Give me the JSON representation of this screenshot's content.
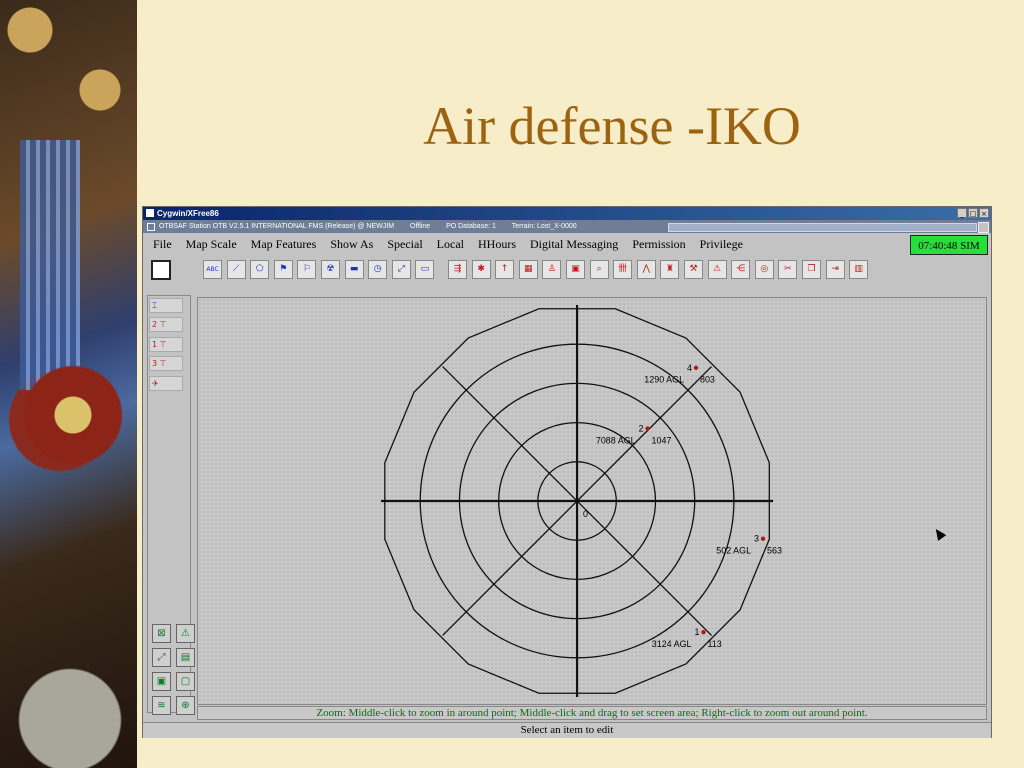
{
  "slide": {
    "title": "Air defense -IKO"
  },
  "window": {
    "xtitle": "Cygwin/XFree86",
    "app_title": "OTBSAF Station OTB V2.5.1 INTERNATIONAL FMS (Release) @ NEWJIM",
    "app_status": "Offline",
    "po_database": "PO Database: 1",
    "terrain": "Terrain: Lost_X-0000"
  },
  "menu": {
    "items": [
      "File",
      "Map Scale",
      "Map Features",
      "Show As",
      "Special",
      "Local",
      "HHours",
      "Digital Messaging",
      "Permission",
      "Privilege"
    ],
    "clock": "07:40:48 SIM"
  },
  "toolbar": {
    "icons": [
      "abc-def-icon",
      "route-icon",
      "area-icon",
      "flag-icon",
      "unit-flag-icon",
      "nbc-icon",
      "tank-icon",
      "clock-icon",
      "line-icon",
      "box-icon",
      "fire-plan-icon",
      "minefield-icon",
      "arrow-up-icon",
      "building-icon",
      "soldier-icon",
      "bunker-icon",
      "magnifier-icon",
      "obstacle-icon",
      "triangle-icon",
      "binoculars-icon",
      "hammer-icon",
      "pyramid-icon",
      "network-icon",
      "target-icon",
      "scissors-icon",
      "copy-icon",
      "exit-icon",
      "bars-icon"
    ],
    "abc_label": "ABC DEF"
  },
  "left_panel": {
    "items": [
      {
        "num": "",
        "icon": "radar-icon"
      },
      {
        "num": "2",
        "icon": "launcher-icon"
      },
      {
        "num": "1",
        "icon": "launcher-icon"
      },
      {
        "num": "3",
        "icon": "launcher-icon"
      },
      {
        "num": "",
        "icon": "aircraft-icon"
      }
    ],
    "bottom_buttons": [
      "grid-toggle-icon",
      "warning-icon",
      "resize-icon",
      "info-icon",
      "select-icon",
      "frame-icon",
      "signal-icon",
      "crosshair-icon"
    ]
  },
  "radar": {
    "center_label": "0",
    "targets": [
      {
        "id": "4",
        "agl": "1290 AGL",
        "range": "803",
        "azimuth_deg": 42,
        "distance_ratio": 0.9
      },
      {
        "id": "2",
        "agl": "7088 AGL",
        "range": "1047",
        "azimuth_deg": 45,
        "distance_ratio": 0.48
      },
      {
        "id": "3",
        "agl": "502 AGL",
        "range": "563",
        "azimuth_deg": 105,
        "distance_ratio": 1.0
      },
      {
        "id": "1",
        "agl": "3124 AGL",
        "range": "113",
        "azimuth_deg": 140,
        "distance_ratio": 1.0
      }
    ]
  },
  "status": {
    "zoom_hint": "Zoom: Middle-click to zoom in around point; Middle-click and drag to set screen area; Right-click to zoom out around point.",
    "select_hint": "Select an item to edit"
  },
  "colors": {
    "title": "#9c6410",
    "clock_bg": "#25e03a",
    "target": "#b01818",
    "hint": "#0f6a12"
  }
}
